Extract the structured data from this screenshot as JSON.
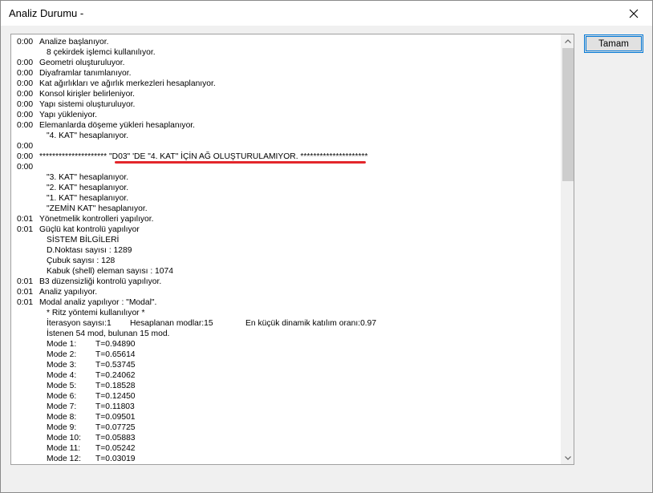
{
  "window": {
    "title": "Analiz Durumu -",
    "ok_label": "Tamam"
  },
  "log": [
    {
      "t": "0:00",
      "m": "Analize başlanıyor."
    },
    {
      "t": "",
      "m": "8 çekirdek işlemci kullanılıyor.",
      "ind": 1
    },
    {
      "t": "0:00",
      "m": "Geometri oluşturuluyor."
    },
    {
      "t": "0:00",
      "m": "Diyaframlar tanımlanıyor."
    },
    {
      "t": "0:00",
      "m": "Kat ağırlıkları ve ağırlık merkezleri hesaplanıyor."
    },
    {
      "t": "0:00",
      "m": "Konsol kirişler belirleniyor."
    },
    {
      "t": "0:00",
      "m": "Yapı sistemi oluşturuluyor."
    },
    {
      "t": "0:00",
      "m": "Yapı yükleniyor."
    },
    {
      "t": "0:00",
      "m": "Elemanlarda döşeme yükleri hesaplanıyor."
    },
    {
      "t": "",
      "m": "\"4. KAT\" hesaplanıyor.",
      "ind": 1
    },
    {
      "t": "0:00",
      "m": ""
    },
    {
      "t": "0:00",
      "m": "********************* \"D03\" 'DE \"4. KAT\" İÇİN AĞ OLUŞTURULAMIYOR. *********************"
    },
    {
      "t": "0:00",
      "m": ""
    },
    {
      "t": "",
      "m": "\"3. KAT\" hesaplanıyor.",
      "ind": 1
    },
    {
      "t": "",
      "m": "\"2. KAT\" hesaplanıyor.",
      "ind": 1
    },
    {
      "t": "",
      "m": "\"1. KAT\" hesaplanıyor.",
      "ind": 1
    },
    {
      "t": "",
      "m": "\"ZEMİN KAT\" hesaplanıyor.",
      "ind": 1
    },
    {
      "t": "0:01",
      "m": "Yönetmelik kontrolleri yapılıyor."
    },
    {
      "t": "0:01",
      "m": "Güçlü kat kontrolü yapılıyor"
    },
    {
      "t": "",
      "m": "SİSTEM BİLGİLERİ",
      "ind": 1
    },
    {
      "t": "",
      "m": "D.Noktası sayısı : 1289",
      "ind": 1
    },
    {
      "t": "",
      "m": "Çubuk sayısı : 128",
      "ind": 1
    },
    {
      "t": "",
      "m": "Kabuk (shell) eleman sayısı : 1074",
      "ind": 1
    },
    {
      "t": "0:01",
      "m": "B3 düzensizliği kontrolü yapılıyor."
    },
    {
      "t": "0:01",
      "m": "Analiz yapılıyor."
    },
    {
      "t": "0:01",
      "m": "Modal analiz yapılıyor : \"Modal\"."
    },
    {
      "t": "",
      "m": "* Ritz yöntemi kullanılıyor *",
      "ind": 1
    },
    {
      "t": "",
      "m": "İterasyon sayısı:1",
      "c2": "Hesaplanan modlar:15",
      "c3": "En küçük dinamik katılım oranı:0.97",
      "ind": 1
    },
    {
      "t": "",
      "m": "İstenen 54 mod, bulunan 15 mod.",
      "ind": 1
    },
    {
      "t": "",
      "m": "Mode 1:",
      "c2": "T=0.94890",
      "ind": 1
    },
    {
      "t": "",
      "m": "Mode 2:",
      "c2": "T=0.65614",
      "ind": 1
    },
    {
      "t": "",
      "m": "Mode 3:",
      "c2": "T=0.53745",
      "ind": 1
    },
    {
      "t": "",
      "m": "Mode 4:",
      "c2": "T=0.24062",
      "ind": 1
    },
    {
      "t": "",
      "m": "Mode 5:",
      "c2": "T=0.18528",
      "ind": 1
    },
    {
      "t": "",
      "m": "Mode 6:",
      "c2": "T=0.12450",
      "ind": 1
    },
    {
      "t": "",
      "m": "Mode 7:",
      "c2": "T=0.11803",
      "ind": 1
    },
    {
      "t": "",
      "m": "Mode 8:",
      "c2": "T=0.09501",
      "ind": 1
    },
    {
      "t": "",
      "m": "Mode 9:",
      "c2": "T=0.07725",
      "ind": 1
    },
    {
      "t": "",
      "m": "Mode 10:",
      "c2": "T=0.05883",
      "ind": 1
    },
    {
      "t": "",
      "m": "Mode 11:",
      "c2": "T=0.05242",
      "ind": 1
    },
    {
      "t": "",
      "m": "Mode 12:",
      "c2": "T=0.03019",
      "ind": 1
    }
  ],
  "icons": {
    "close": "close-icon",
    "scroll_up": "chevron-up-icon",
    "scroll_down": "chevron-down-icon"
  },
  "colors": {
    "highlight_underline": "#e3262b",
    "button_border": "#0078d7"
  }
}
